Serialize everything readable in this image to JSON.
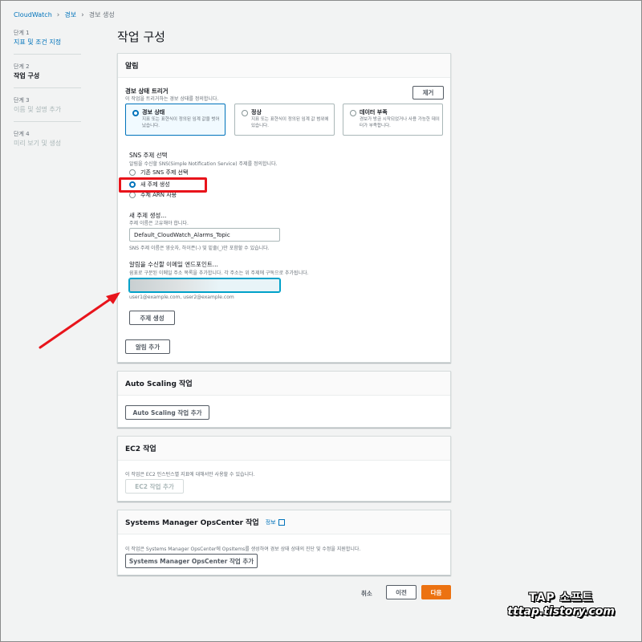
{
  "breadcrumb": {
    "root": "CloudWatch",
    "parent": "경보",
    "current": "경보 생성"
  },
  "steps": [
    {
      "num": "단계 1",
      "title": "지표 및 조건 지정",
      "state": "link"
    },
    {
      "num": "단계 2",
      "title": "작업 구성",
      "state": "active"
    },
    {
      "num": "단계 3",
      "title": "이름 및 설명 추가",
      "state": "disabled"
    },
    {
      "num": "단계 4",
      "title": "미리 보기 및 생성",
      "state": "disabled"
    }
  ],
  "page_title": "작업 구성",
  "notification": {
    "header": "알림",
    "trigger_label": "경보 상태 트리거",
    "trigger_desc": "이 작업을 트리거하는 경보 상태를 정의합니다.",
    "remove_button": "제거",
    "tiles": [
      {
        "title": "경보 상태",
        "desc": "지표 또는 표현식이 정의된 임계 값을 벗어났습니다.",
        "selected": true
      },
      {
        "title": "정상",
        "desc": "지표 또는 표현식이 정의된 임계 값 범위에 있습니다.",
        "selected": false
      },
      {
        "title": "데이터 부족",
        "desc": "경보가 방금 시작되었거나 사용 가능한 데이터가 부족합니다.",
        "selected": false
      }
    ],
    "sns_label": "SNS 주제 선택",
    "sns_desc": "알림을 수신할 SNS(Simple Notification Service) 주제를 정의합니다.",
    "sns_options": [
      "기존 SNS 주제 선택",
      "새 주제 생성",
      "주제 ARN 사용"
    ],
    "sns_selected": 1,
    "new_topic_label": "새 주제 생성...",
    "new_topic_desc": "주제 이름은 고유해야 합니다.",
    "topic_name_value": "Default_CloudWatch_Alarms_Topic",
    "topic_name_hint": "SNS 주제 이름은 영숫자, 하이픈(-) 및 밑줄(_)만 포함할 수 있습니다.",
    "email_label": "알림을 수신할 이메일 엔드포인트...",
    "email_desc": "쉼표로 구분된 이메일 주소 목록을 추가합니다. 각 주소는 위 주제에 구독으로 추가됩니다.",
    "email_value": "",
    "email_hint": "user1@example.com, user2@example.com",
    "create_topic_button": "주제 생성",
    "add_notification_button": "알림 추가"
  },
  "autoscaling": {
    "header": "Auto Scaling 작업",
    "add_button": "Auto Scaling 작업 추가"
  },
  "ec2": {
    "header": "EC2 작업",
    "desc": "이 작업은 EC2 인스턴스별 지표에 대해서만 사용할 수 있습니다.",
    "add_button": "EC2 작업 추가"
  },
  "opscenter": {
    "header": "Systems Manager OpsCenter 작업",
    "info_link": "정보",
    "desc": "이 작업은 Systems Manager OpsCenter에 OpsItems를 생성하여 경보 상태 상태의 진단 및 수정을 지원합니다.",
    "add_button": "Systems Manager OpsCenter 작업 추가"
  },
  "footer": {
    "cancel": "취소",
    "previous": "이전",
    "next": "다음"
  },
  "watermark": {
    "line1": "TAP 소프트",
    "line2": "tttap.tistory.com"
  },
  "colors": {
    "accent": "#0073bb",
    "primary_button": "#ec7211",
    "annotation_red": "#e8141b"
  }
}
